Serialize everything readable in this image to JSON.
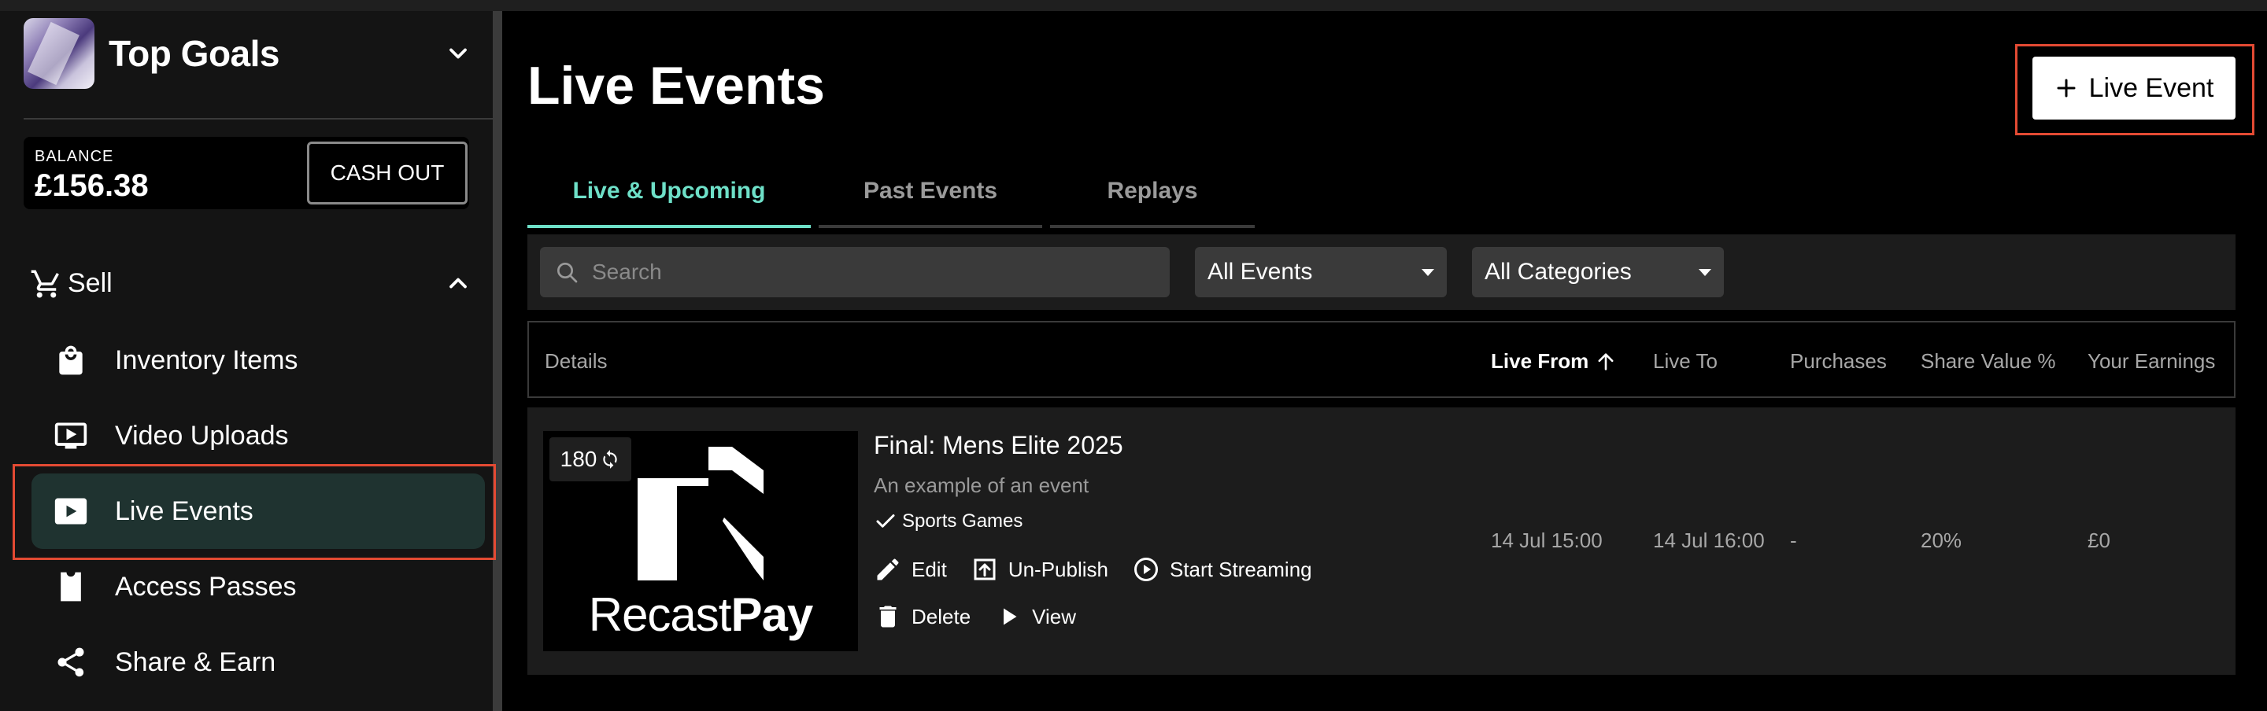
{
  "sidebar": {
    "brand_name": "Top Goals",
    "balance_label": "BALANCE",
    "balance_value": "£156.38",
    "cash_out_label": "CASH OUT",
    "section_label": "Sell",
    "items": [
      {
        "label": "Inventory Items",
        "icon": "shopping-bag-icon"
      },
      {
        "label": "Video Uploads",
        "icon": "video-upload-icon"
      },
      {
        "label": "Live Events",
        "icon": "play-box-icon",
        "active": true
      },
      {
        "label": "Access Passes",
        "icon": "pass-icon"
      },
      {
        "label": "Share & Earn",
        "icon": "share-icon"
      }
    ]
  },
  "main": {
    "title": "Live Events",
    "add_button_label": "Live Event",
    "tabs": [
      {
        "label": "Live & Upcoming",
        "active": true
      },
      {
        "label": "Past Events"
      },
      {
        "label": "Replays"
      }
    ],
    "search_placeholder": "Search",
    "filter_events": "All Events",
    "filter_categories": "All Categories",
    "columns": {
      "details": "Details",
      "live_from": "Live From",
      "live_to": "Live To",
      "purchases": "Purchases",
      "share_value": "Share Value %",
      "earnings": "Your Earnings"
    },
    "event": {
      "badge": "180",
      "thumb_brand_light": "Recast",
      "thumb_brand_bold": "Pay",
      "title": "Final: Mens Elite 2025",
      "description": "An example of an event",
      "category": "Sports Games",
      "actions": {
        "edit": "Edit",
        "unpublish": "Un-Publish",
        "start_streaming": "Start Streaming",
        "delete": "Delete",
        "view": "View"
      },
      "live_from": "14 Jul 15:00",
      "live_to": "14 Jul 16:00",
      "purchases": "-",
      "share_value": "20%",
      "earnings": "£0"
    }
  },
  "colors": {
    "accent": "#6ee0c8",
    "highlight": "#e34a33",
    "active_nav_bg": "#1f3330"
  }
}
